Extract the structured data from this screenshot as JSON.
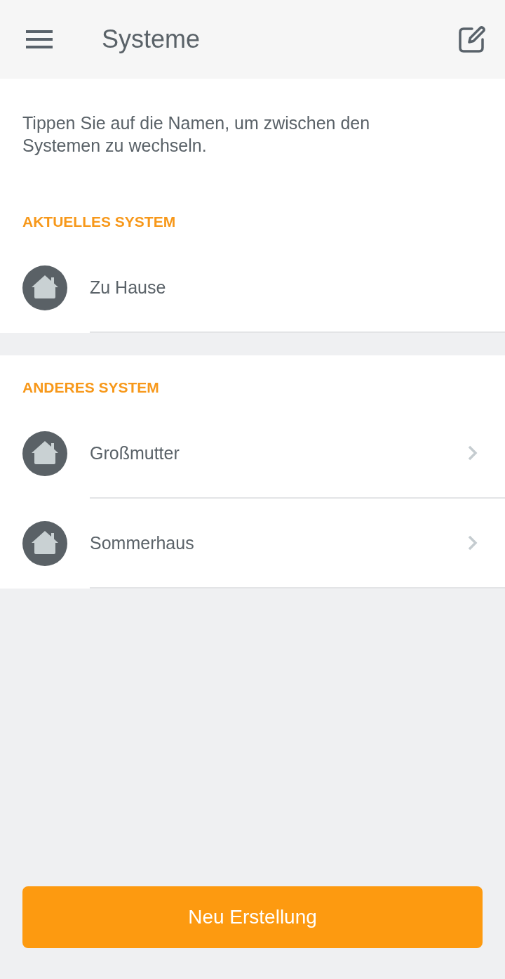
{
  "header": {
    "title": "Systeme"
  },
  "intro": "Tippen Sie auf die Namen, um zwischen den Systemen zu wechseln.",
  "sections": [
    {
      "heading": "AKTUELLES SYSTEM",
      "items": [
        {
          "name": "Zu Hause",
          "chevron": false
        }
      ]
    },
    {
      "heading": "ANDERES SYSTEM",
      "items": [
        {
          "name": "Großmutter",
          "chevron": true
        },
        {
          "name": "Sommerhaus",
          "chevron": true
        }
      ]
    }
  ],
  "primary_button": "Neu Erstellung"
}
